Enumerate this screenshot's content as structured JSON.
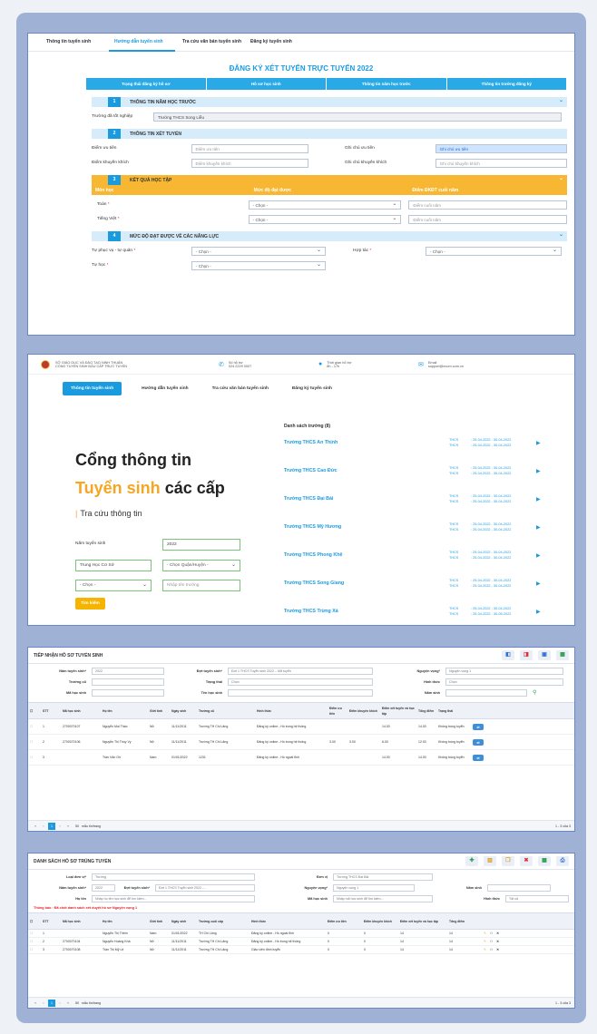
{
  "form": {
    "nav": [
      "Thông tin tuyển sinh",
      "Hướng dẫn tuyển sinh",
      "Tra cứu văn bản tuyển sinh",
      "Đăng ký tuyển sinh"
    ],
    "title": "ĐĂNG KÝ XÉT TUYỂN TRỰC TUYẾN 2022",
    "steps": [
      "Trạng thái đăng ký hồ sơ",
      "Hồ sơ học sinh",
      "Thông tin năm học trước",
      "Thông tin trường đăng ký"
    ],
    "s1": {
      "num": "1",
      "title": "THÔNG TIN NĂM HỌC TRƯỚC",
      "label": "Trường đã tốt nghiệp",
      "value": "Trường THCS Song Liễu"
    },
    "s2": {
      "num": "2",
      "title": "THÔNG TIN XÉT TUYỂN",
      "l1": "Điểm ưu tiên",
      "p1": "Điểm ưu tiên",
      "l2": "Ghi chú ưu tiên",
      "p2": "Ghi chú ưu tiên",
      "l3": "Điểm khuyến khích",
      "p3": "Điểm khuyến khích",
      "l4": "Ghi chú khuyến khích",
      "p4": "Ghi chú khuyến khích"
    },
    "s3": {
      "num": "3",
      "title": "KẾT QUẢ HỌC TẬP",
      "cols": [
        "Môn học",
        "Mức độ đạt được",
        "Điểm ĐKĐT cuối năm"
      ],
      "rows": [
        {
          "sub": "Toán",
          "sel": "- Chọn -",
          "ph": "Điểm cuối năm"
        },
        {
          "sub": "Tiếng Việt",
          "sel": "- Chọn -",
          "ph": "Điểm cuối năm"
        }
      ]
    },
    "s4": {
      "num": "4",
      "title": "MỨC ĐỘ ĐẠT ĐƯỢC VỀ CÁC NĂNG LỰC",
      "l1": "Tự phục vụ - tự quản",
      "v1": "- Chọn -",
      "l2": "Hợp tác",
      "v2": "- Chọn -",
      "l3": "Tự học",
      "v3": "- Chọn -"
    },
    "star": "*"
  },
  "portal": {
    "org1": "SỞ GIÁO DỤC VÀ ĐÀO TẠO NINH THUẬN",
    "org2": "CỔNG TUYỂN SINH ĐẦU CẤP TRỰC TUYẾN",
    "phone_l": "Số hỗ trợ",
    "phone": "024 2229 0007",
    "time_l": "Thời gian hỗ trợ",
    "time": "8h - 17h",
    "email_l": "Email",
    "email": "support@ecom.com.vn",
    "nav": [
      "Thông tin tuyển sinh",
      "Hướng dẫn tuyển sinh",
      "Tra cứu văn bản tuyển sinh",
      "Đăng ký tuyển sinh"
    ],
    "h1": "Cổng thông tin",
    "h2a": "Tuyển sinh",
    "h2b": "các cấp",
    "h3": "Tra cứu thông tin",
    "bar": "|",
    "year_l": "Năm tuyển sinh",
    "year": "2022",
    "level": "Trung Học Cơ Sở",
    "district": "- Chọn Quận/Huyện -",
    "choose": "- Chọn -",
    "school_ph": "Nhập tên trường",
    "search": "Tìm kiếm",
    "list_title": "Danh sách trường (8)",
    "schools": [
      {
        "name": "Trường THCS An Thịnh",
        "d1": "25-04-2022 - 30-04-2022",
        "d2": "25-04-2022 - 30-04-2022"
      },
      {
        "name": "Trường THCS Cao Đức",
        "d1": "25-04-2022 - 30-04-2022",
        "d2": "25-04-2022 - 30-04-2022"
      },
      {
        "name": "Trường THCS Đại Bái",
        "d1": "25-04-2022 - 30-04-2022",
        "d2": "25-04-2022 - 30-04-2022"
      },
      {
        "name": "Trường THCS Mỹ Hương",
        "d1": "25-04-2022 - 30-04-2022",
        "d2": "25-04-2022 - 30-04-2022"
      },
      {
        "name": "Trường THCS Phong Khê",
        "d1": "25-04-2022 - 30-04-2022",
        "d2": "25-04-2022 - 30-04-2022"
      },
      {
        "name": "Trường THCS Song Giang",
        "d1": "25-04-2022 - 30-04-2022",
        "d2": "25-04-2022 - 30-04-2022"
      },
      {
        "name": "Trường THCS Trừng Xá",
        "d1": "25-04-2022 - 30-04-2022",
        "d2": "25-04-2022 - 30-05-2022"
      }
    ],
    "type": "THCS",
    "colon": ":",
    "arrow": "▶"
  },
  "recv": {
    "title": "TIẾP NHẬN HỒ SƠ TUYỂN SINH",
    "f_year_l": "Năm tuyển sinh*",
    "f_year": "2022",
    "f_round_l": "Đợt tuyển sinh*",
    "f_round": "Đợt 1 THCS Tuyển sinh 2022 – Mã tuyển",
    "f_wish_l": "Nguyện vọng*",
    "f_wish": "Nguyện vọng 1",
    "f_school_l": "Trường cũ",
    "f_state_l": "Trạng thái",
    "f_state": "Chọn",
    "f_form_l": "Hình thức",
    "f_form": "Chọn",
    "f_code_l": "Mã học sinh",
    "f_name_l": "Tên học sinh",
    "f_dob_l": "Năm sinh",
    "cols": [
      "STT",
      "Mã học sinh",
      "Họ tên",
      "Giới tính",
      "Ngày sinh",
      "Trường cũ",
      "Hình thức",
      "Điểm ưu tiên",
      "Điểm khuyến khích",
      "Điểm xét tuyển và học tập",
      "Tổng điểm",
      "Trạng thái"
    ],
    "rows": [
      [
        "1",
        "2700070107",
        "Nguyễn Mai Thảo",
        "Nữ",
        "11/11/2011",
        "Trường TH Chi Lăng",
        "Đăng ký online - Hồ trong hệ thống",
        "",
        "",
        "14.00",
        "14.00",
        "Không trúng tuyển"
      ],
      [
        "2",
        "2700070106",
        "Nguyễn Thị Thúy Vy",
        "Nữ",
        "11/11/2011",
        "Trường TH Chi Lăng",
        "Đăng ký online - Hồ trong hệ thống",
        "3.00",
        "3.00",
        "6.00",
        "12.00",
        "Không trúng tuyển"
      ],
      [
        "3",
        "",
        "Trần Văn Ơn",
        "Nam",
        "01/01/2022",
        "1231",
        "Đăng ký online - Hồ ngoài tỉnh",
        "",
        "",
        "14.00",
        "14.00",
        "Không trúng tuyển"
      ]
    ],
    "per": "50",
    "per_l": "mẫu tin/trang",
    "count": "1 - 3 của 3"
  },
  "pass": {
    "title": "DANH SÁCH HỒ SƠ TRÚNG TUYỂN",
    "f_unit_l": "Loại đơn vị*",
    "f_unit": "Trường",
    "f_dv_l": "Đơn vị",
    "f_dv": "Trường THCS Đại Bái",
    "f_year_l": "Năm tuyển sinh*",
    "f_year": "2022",
    "f_round_l": "Đợt tuyển sinh*",
    "f_round": "Đợt 1 THCS Tuyển sinh 2022 -...",
    "f_wish_l": "Nguyện vọng*",
    "f_wish": "Nguyện vọng 1",
    "f_dob_l": "Năm sinh",
    "f_name_l": "Họ tên",
    "f_name": "Nhập họ tên học sinh để tìm kiếm...",
    "f_code_l": "Mã học sinh",
    "f_code": "Nhập mã học sinh để tìm kiếm...",
    "f_form_l": "Hình thức",
    "f_form": "Tất cả",
    "warn": "Thông báo : Đã chốt danh sách xét duyệt hồ sơ Nguyện vọng 1",
    "cols": [
      "STT",
      "Mã học sinh",
      "Họ tên",
      "Giới tính",
      "Ngày sinh",
      "Trường cuối cấp",
      "Hình thức",
      "Điểm ưu tiên",
      "Điểm khuyến khích",
      "Điểm xét tuyển và học tập",
      "Tổng điểm"
    ],
    "rows": [
      [
        "1",
        "",
        "Nguyễn Thị Thêm",
        "Nam",
        "01/01/2022",
        "TH Chi Lăng",
        "Đăng ký online - Hồ ngoài tỉnh",
        "0",
        "0",
        "14",
        "14"
      ],
      [
        "2",
        "2700070104",
        "Nguyễn Hoàng Khá",
        "Nữ",
        "11/11/2011",
        "Trường TH Chi Lăng",
        "Đăng ký online - Hồ trong hệ thống",
        "0",
        "0",
        "14",
        "14"
      ],
      [
        "3",
        "2700070108",
        "Trần Thị Mỹ Lệ",
        "Nữ",
        "11/11/2011",
        "Trường TH Chi Lăng",
        "Giáo viên đính tuyển",
        "0",
        "0",
        "14",
        "14"
      ]
    ],
    "per": "50",
    "per_l": "mẫu tin/trang",
    "count": "1 - 3 của 3"
  }
}
